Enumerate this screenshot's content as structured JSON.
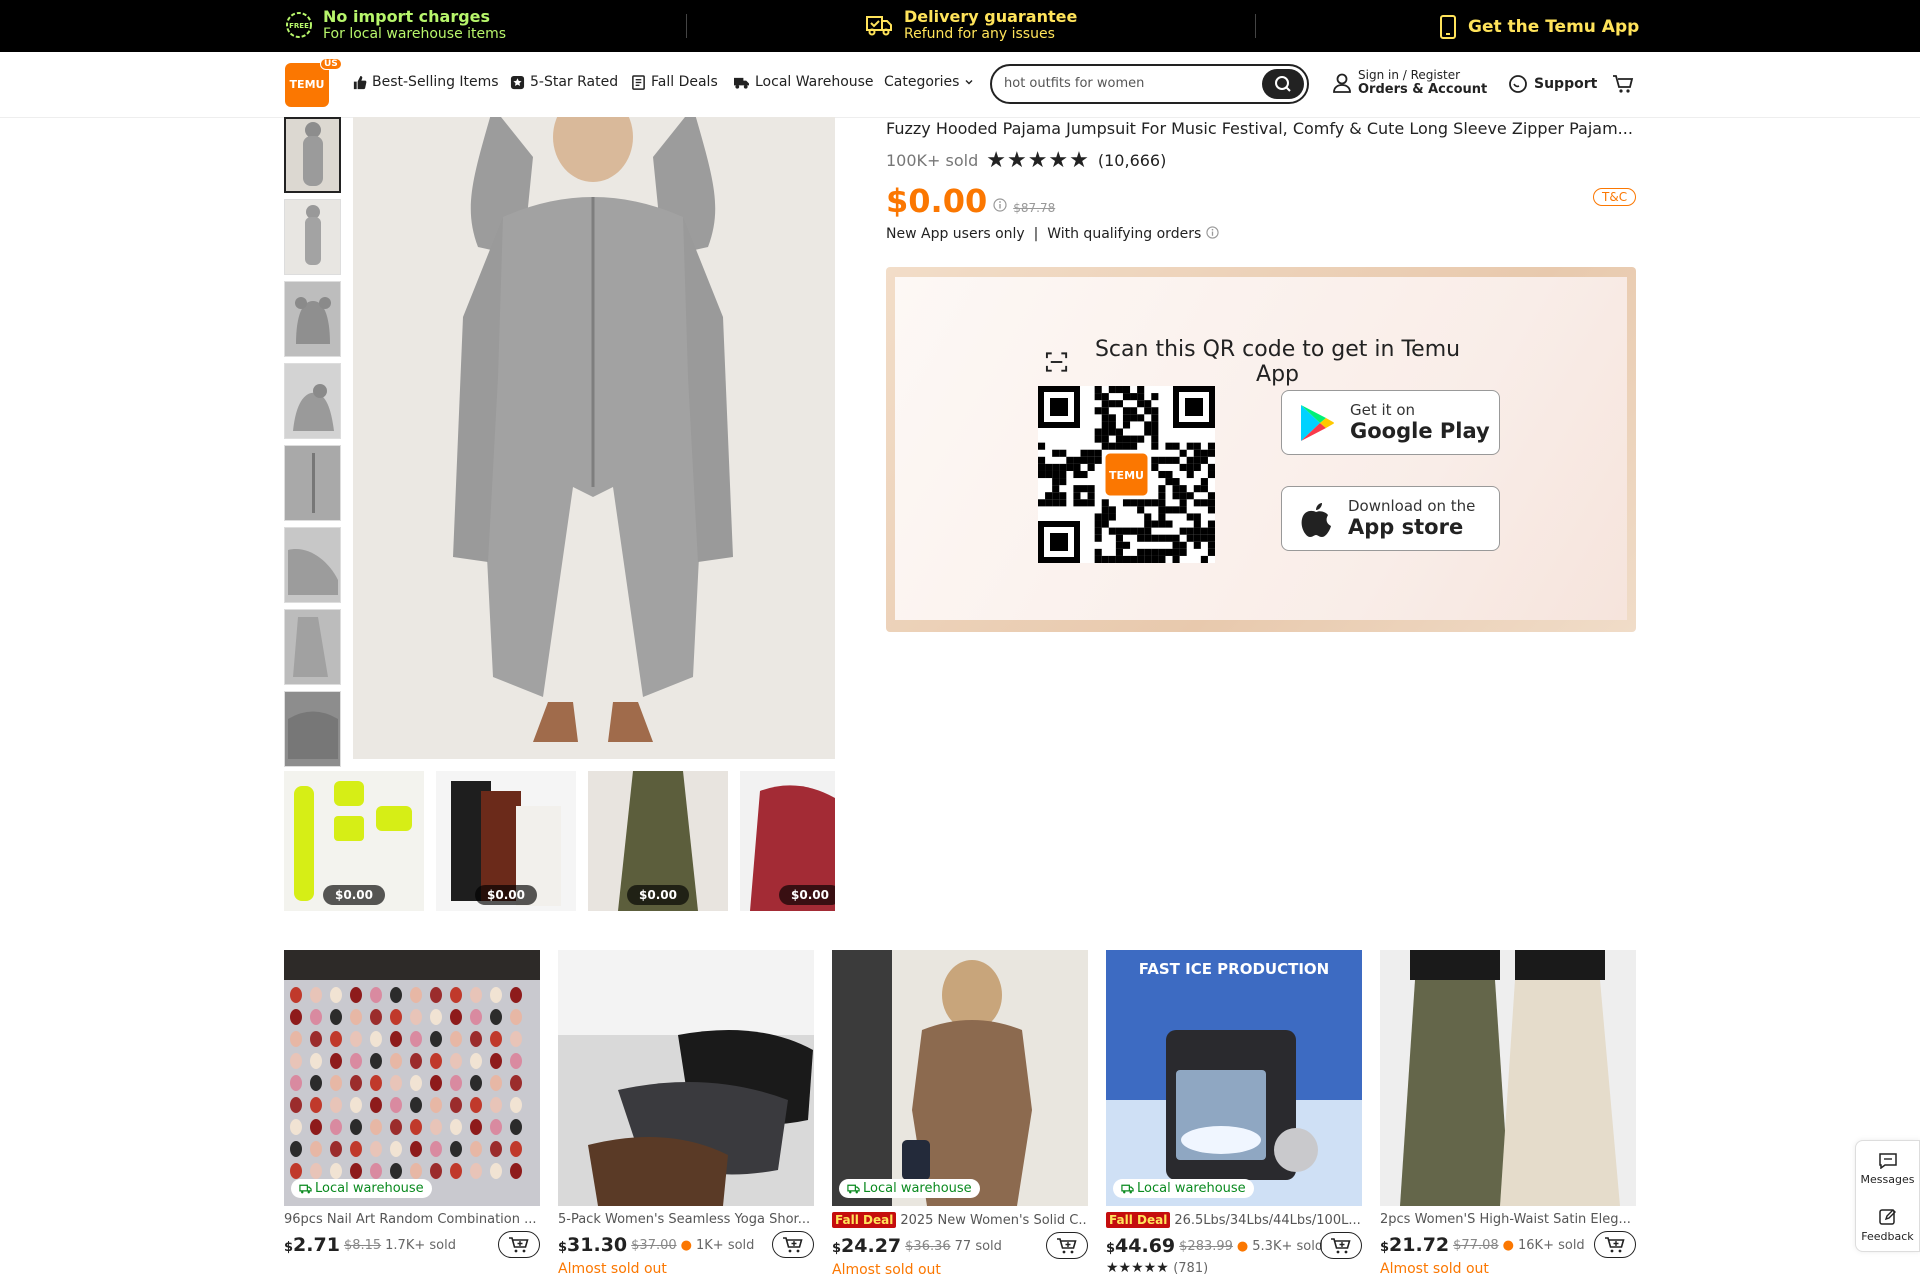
{
  "topbar": {
    "import_title": "No import charges",
    "import_sub": "For local warehouse items",
    "delivery_title": "Delivery guarantee",
    "delivery_sub": "Refund for any issues",
    "app_label": "Get the Temu App",
    "free_icon_text": "FREE"
  },
  "header": {
    "logo_text": "TEMU",
    "logo_region": "US",
    "nav": [
      "Best-Selling Items",
      "5-Star Rated",
      "Fall Deals",
      "Local Warehouse",
      "Categories"
    ],
    "search_placeholder": "hot outfits for women",
    "signin_top": "Sign in / Register",
    "signin_bottom": "Orders & Account",
    "support": "Support"
  },
  "product": {
    "title": "Fuzzy Hooded Pajama Jumpsuit For Music Festival, Comfy & Cute Long Sleeve Zipper Pajam...",
    "sold": "100K+ sold",
    "rating_stars": 5,
    "reviews": "(10,666)",
    "price": "$0.00",
    "old_price": "$87.78",
    "tc": "T&C",
    "note": "New App users only  |  With qualifying orders"
  },
  "related": [
    {
      "price": "$0.00"
    },
    {
      "price": "$0.00"
    },
    {
      "price": "$0.00"
    },
    {
      "price": "$0.00"
    }
  ],
  "qr": {
    "title": "Scan this QR code to get in Temu App",
    "google_small": "Get it on",
    "google_big": "Google Play",
    "apple_small": "Download on the",
    "apple_big": "App store"
  },
  "products": [
    {
      "badge": "Local warehouse",
      "fall": "",
      "title": "96pcs Nail Art Random Combination ...",
      "cur": "$",
      "price": "2.71",
      "old": "$8.15",
      "sold": "1.7K+ sold",
      "alert": "",
      "stars": ""
    },
    {
      "badge": "",
      "fall": "",
      "title": "5-Pack Women's Seamless Yoga Shor...",
      "cur": "$",
      "price": "31.30",
      "old": "$37.00",
      "sold": "1K+ sold",
      "alert": "Almost sold out",
      "stars": ""
    },
    {
      "badge": "Local warehouse",
      "fall": "Fall Deal",
      "title": "2025 New Women's Solid C...",
      "cur": "$",
      "price": "24.27",
      "old": "$36.36",
      "sold": "77 sold",
      "alert": "Almost sold out",
      "stars": ""
    },
    {
      "badge": "Local warehouse",
      "fall": "Fall Deal",
      "title": "26.5Lbs/34Lbs/44Lbs/100L...",
      "cur": "$",
      "price": "44.69",
      "old": "$283.99",
      "sold": "5.3K+ sold",
      "alert": "",
      "stars": "(781)",
      "image_text": "FAST ICE PRODUCTION"
    },
    {
      "badge": "",
      "fall": "",
      "title": "2pcs Women'S High-Waist Satin Eleg...",
      "cur": "$",
      "price": "21.72",
      "old": "$77.08",
      "sold": "16K+ sold",
      "alert": "Almost sold out",
      "stars": ""
    }
  ],
  "side": {
    "messages": "Messages",
    "feedback": "Feedback"
  },
  "colors": {
    "accent": "#fb7701",
    "green": "#b7f56b",
    "yellow": "#ffe35a"
  }
}
